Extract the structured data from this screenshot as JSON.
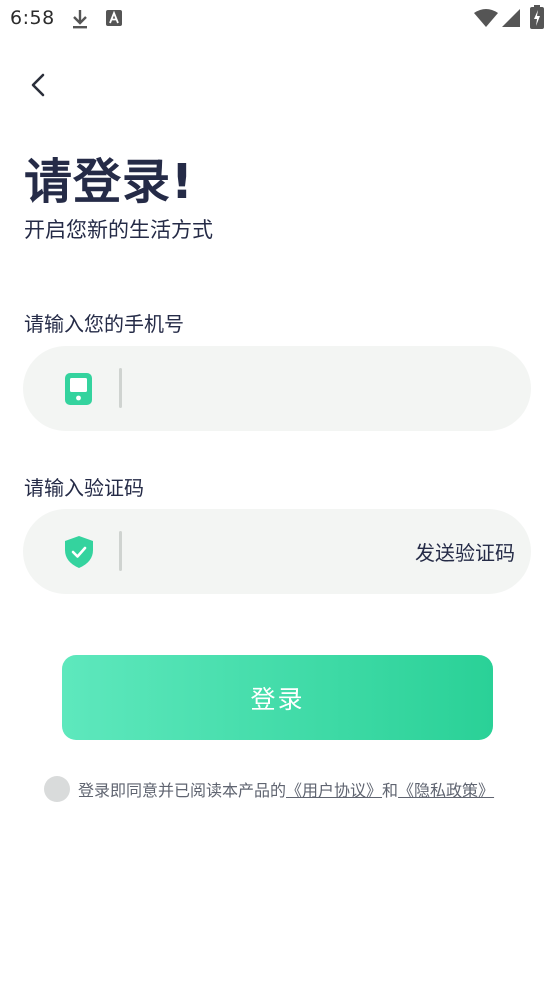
{
  "status_bar": {
    "time": "6:58",
    "icons": [
      "download-icon",
      "a-icon",
      "wifi-icon",
      "signal-icon",
      "battery-icon"
    ]
  },
  "colors": {
    "accent": "#34d39e",
    "accent_light": "#5ee8bd",
    "title": "#252b47",
    "field_bg": "#f3f5f3"
  },
  "page": {
    "title": "请登录!",
    "subtitle": "开启您新的生活方式"
  },
  "phone_field": {
    "label": "请输入您的手机号",
    "value": "",
    "placeholder": "",
    "icon": "phone-icon"
  },
  "code_field": {
    "label": "请输入验证码",
    "value": "",
    "placeholder": "",
    "icon": "shield-check-icon",
    "send_code_label": "发送验证码"
  },
  "login_button": {
    "label": "登录"
  },
  "agreement": {
    "checked": false,
    "prefix": "登录即同意并已阅读本产品的",
    "user_agreement": "《用户协议》",
    "conjunction": "和",
    "privacy_policy": "《隐私政策》"
  }
}
